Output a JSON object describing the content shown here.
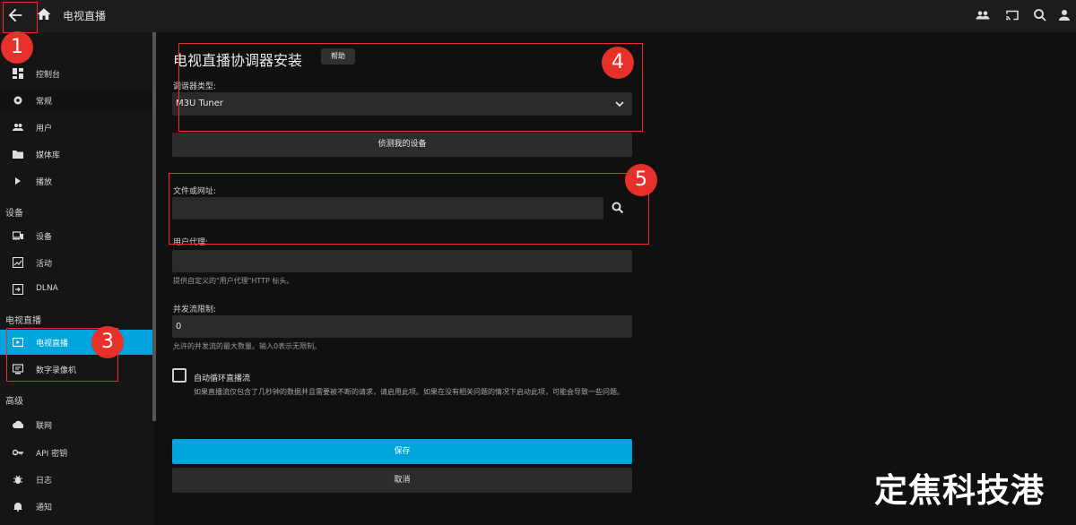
{
  "topbar": {
    "title": "电视直播",
    "icons": [
      "back-arrow-icon",
      "home-icon",
      "users-icon",
      "cast-icon",
      "search-icon",
      "account-icon"
    ]
  },
  "sidebar": {
    "items_top": [
      {
        "label": "控制台",
        "icon": "dashboard-icon"
      },
      {
        "label": "常规",
        "icon": "gear-icon"
      },
      {
        "label": "用户",
        "icon": "users-icon"
      },
      {
        "label": "媒体库",
        "icon": "folder-icon"
      },
      {
        "label": "播放",
        "icon": "play-icon"
      }
    ],
    "section_devices": "设备",
    "items_devices": [
      {
        "label": "设备",
        "icon": "devices-icon"
      },
      {
        "label": "活动",
        "icon": "activity-icon"
      },
      {
        "label": "DLNA",
        "icon": "dlna-icon"
      }
    ],
    "section_livetv": "电视直播",
    "items_livetv": [
      {
        "label": "电视直播",
        "icon": "live-tv-icon"
      },
      {
        "label": "数字录像机",
        "icon": "dvr-icon"
      }
    ],
    "section_advanced": "高级",
    "items_advanced": [
      {
        "label": "联网",
        "icon": "cloud-icon"
      },
      {
        "label": "API 密钥",
        "icon": "key-icon"
      },
      {
        "label": "日志",
        "icon": "bug-icon"
      },
      {
        "label": "通知",
        "icon": "bell-icon"
      }
    ]
  },
  "form": {
    "title": "电视直播协调器安装",
    "help_label": "帮助",
    "tuner_type_label": "调谐器类型:",
    "tuner_type_value": "M3U Tuner",
    "detect_label": "侦测我的设备",
    "file_url_label": "文件或网址:",
    "file_url_value": "",
    "user_agent_label": "用户代理:",
    "user_agent_value": "",
    "user_agent_hint": "提供自定义的\"用户代理\"HTTP 标头。",
    "stream_limit_label": "并发流限制:",
    "stream_limit_value": "0",
    "stream_limit_hint": "允许的并发流的最大数量。输入0表示无限制。",
    "auto_loop_label": "自动循环直播流",
    "auto_loop_checked": false,
    "auto_loop_desc": "如果直播流仅包含了几秒钟的数据并且需要被不断的请求，请启用此项。如果在没有相关问题的情况下启动此项，可能会导致一些问题。",
    "save_label": "保存",
    "cancel_label": "取消"
  },
  "annotations": {
    "markers": [
      "1",
      "3",
      "4",
      "5"
    ],
    "color": "#e8302a"
  },
  "colors": {
    "accent": "#00a4dc",
    "background": "#101010",
    "sidebar": "#151515",
    "field": "#2a2a2a"
  },
  "watermark": "定焦科技港"
}
